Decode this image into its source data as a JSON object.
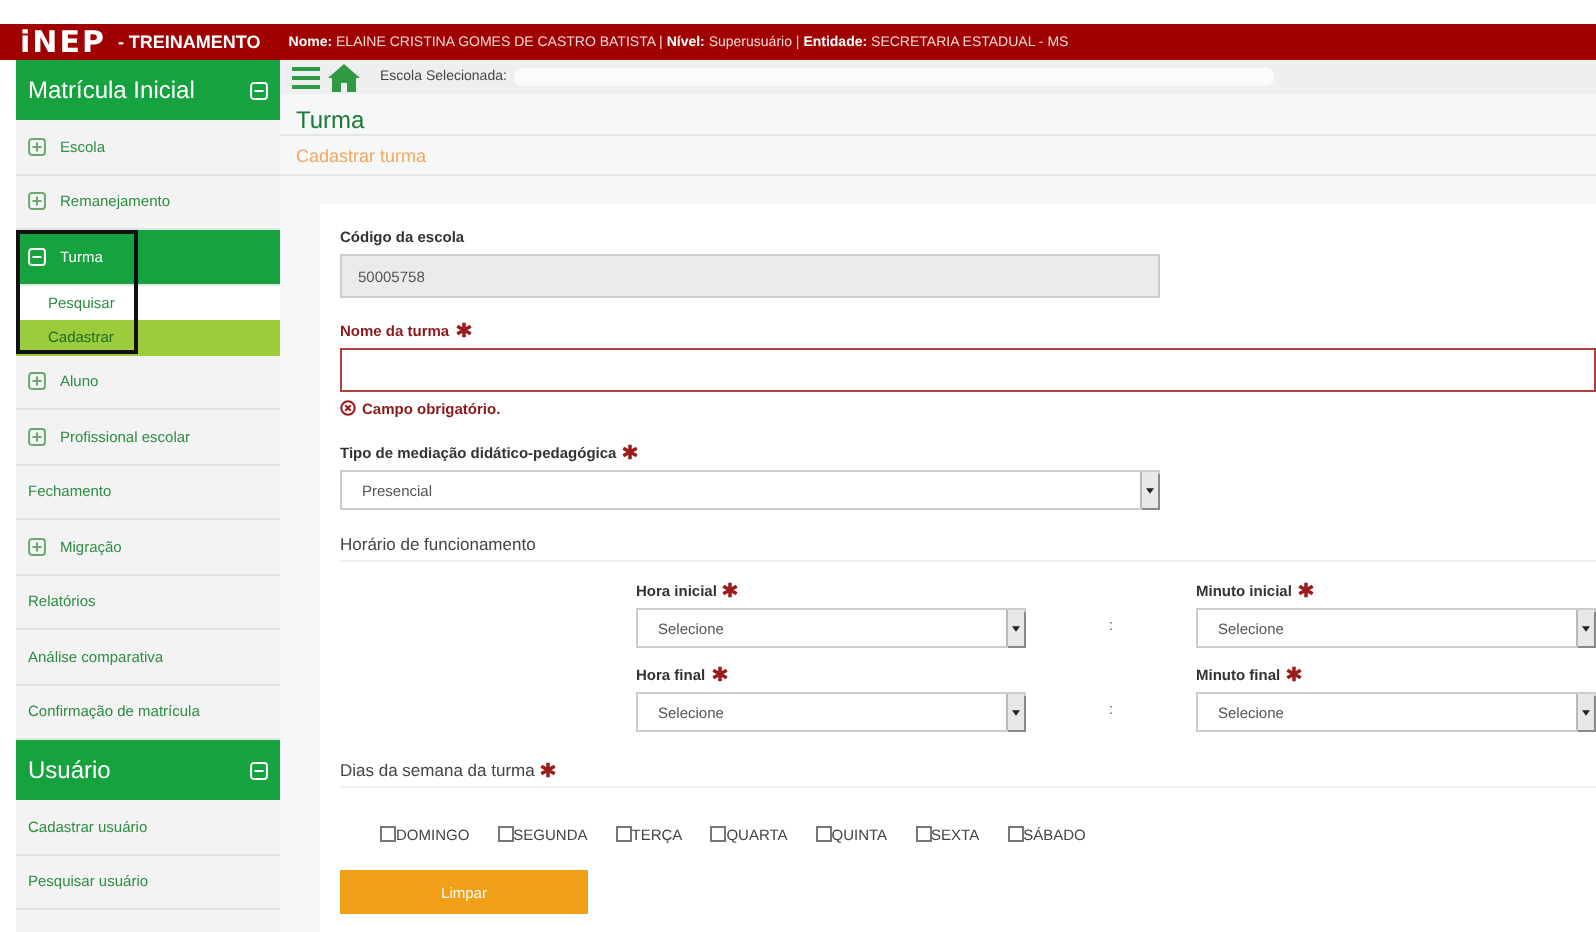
{
  "header": {
    "logo": "iNEP",
    "environment": "- TREINAMENTO",
    "user_info": "**Nome:** ELAINE CRISTINA GOMES DE CASTRO BATISTA | **Nível:** Superusuário | **Entidade:** SECRETARIA ESTADUAL - MS"
  },
  "sidebar": {
    "sections": [
      {
        "title": "Matrícula Inicial",
        "expanded": true,
        "items": [
          {
            "kind": "group",
            "label": "Escola",
            "expanded": false,
            "selected": false
          },
          {
            "kind": "group",
            "label": "Remanejamento",
            "expanded": false,
            "selected": false
          },
          {
            "kind": "group",
            "label": "Turma",
            "expanded": true,
            "selected": true,
            "highlighted": true,
            "children": [
              {
                "label": "Pesquisar",
                "selected": false
              },
              {
                "label": "Cadastrar",
                "selected": true
              }
            ]
          },
          {
            "kind": "group",
            "label": "Aluno",
            "expanded": false,
            "selected": false
          },
          {
            "kind": "group",
            "label": "Profissional escolar",
            "expanded": false,
            "selected": false
          },
          {
            "kind": "link",
            "label": "Fechamento",
            "selected": false
          },
          {
            "kind": "group",
            "label": "Migração",
            "expanded": false,
            "selected": false
          },
          {
            "kind": "link",
            "label": "Relatórios",
            "selected": false
          },
          {
            "kind": "link",
            "label": "Análise comparativa",
            "selected": false
          },
          {
            "kind": "link",
            "label": "Confirmação de matrícula",
            "selected": false
          }
        ]
      },
      {
        "title": "Usuário",
        "expanded": true,
        "items": [
          {
            "kind": "link",
            "label": "Cadastrar usuário",
            "selected": false
          },
          {
            "kind": "link",
            "label": "Pesquisar usuário",
            "selected": false
          }
        ]
      }
    ]
  },
  "toolbar": {
    "school_label": "Escola Selecionada:"
  },
  "page": {
    "title": "Turma",
    "subtitle": "Cadastrar turma"
  },
  "form": {
    "school_code": {
      "label": "Código da escola",
      "value": "50005758",
      "disabled": true
    },
    "class_name": {
      "label": "Nome da turma",
      "required": true,
      "invalid": true,
      "error": "Campo obrigatório."
    },
    "mediation": {
      "label": "Tipo de mediação didático-pedagógica",
      "required": true,
      "value": "Presencial"
    },
    "schedule": {
      "title": "Horário de funcionamento",
      "separator": ":",
      "rows": [
        {
          "hour": {
            "label": "Hora inicial",
            "required": true,
            "value": "Selecione"
          },
          "minute": {
            "label": "Minuto inicial",
            "required": true,
            "value": "Selecione"
          }
        },
        {
          "hour": {
            "label": "Hora final",
            "required": true,
            "value": "Selecione"
          },
          "minute": {
            "label": "Minuto final",
            "required": true,
            "value": "Selecione"
          }
        }
      ]
    },
    "weekdays": {
      "title": "Dias da semana da turma",
      "required": true,
      "days": [
        {
          "label": "DOMINGO",
          "checked": false
        },
        {
          "label": "SEGUNDA",
          "checked": false
        },
        {
          "label": "TERÇA",
          "checked": false
        },
        {
          "label": "QUARTA",
          "checked": false
        },
        {
          "label": "QUINTA",
          "checked": false
        },
        {
          "label": "SEXTA",
          "checked": false
        },
        {
          "label": "SÁBADO",
          "checked": false
        }
      ]
    },
    "buttons": [
      {
        "label": "Limpar"
      }
    ]
  }
}
